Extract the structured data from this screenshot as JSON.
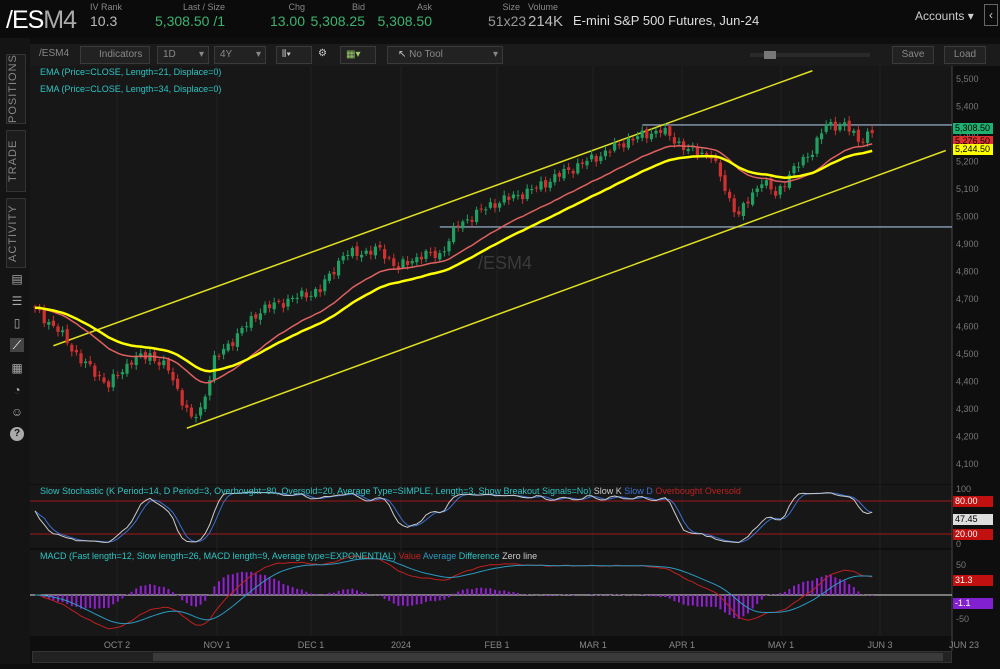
{
  "header": {
    "symbol_main": "/ES",
    "symbol_sub": "M4",
    "quotes": [
      {
        "label": "IV Rank",
        "value": "10.3",
        "color": "#bbbbbb"
      },
      {
        "label": "Last / Size",
        "value": "5,308.50 /1",
        "color": "#3cb371"
      },
      {
        "label": "Chg",
        "value": "13.00",
        "color": "#3cb371"
      },
      {
        "label": "Bid",
        "value": "5,308.25",
        "color": "#3cb371"
      },
      {
        "label": "Ask",
        "value": "5,308.50",
        "color": "#3cb371"
      },
      {
        "label": "Size",
        "value": "51x23",
        "color": "#999999"
      },
      {
        "label": "Volume",
        "value": "214K",
        "color": "#bbbbbb"
      }
    ],
    "description": "E-mini S&P 500 Futures, Jun-24",
    "accounts": "Accounts",
    "accounts_chevron": "▾",
    "collapse": "‹"
  },
  "sidebar": {
    "tabs": [
      "POSITIONS",
      "TRADE",
      "ACTIVITY"
    ],
    "icons": [
      "notes-icon",
      "list-icon",
      "clipboard-icon",
      "chart-drawing-icon",
      "grid-icon",
      "gauge-icon",
      "people-icon",
      "help-icon"
    ]
  },
  "toolbar": {
    "symbol": "/ESM4",
    "indicators": "Indicators",
    "aggregation": "1D",
    "timeframe": "4Y",
    "tool": "No Tool",
    "save": "Save",
    "load": "Load"
  },
  "chart_data": {
    "type": "candlestick",
    "watermark": "/ESM4",
    "legend": [
      "EMA (Price=CLOSE, Length=21, Displace=0)",
      "EMA (Price=CLOSE, Length=34, Displace=0)"
    ],
    "y_ticks": [
      "5,500",
      "5,400",
      "5,300",
      "5,200",
      "5,100",
      "5,000",
      "4,900",
      "4,800",
      "4,700",
      "4,600",
      "4,500",
      "4,400",
      "4,300",
      "4,200",
      "4,100"
    ],
    "ylim": [
      4050,
      5560
    ],
    "price_tags": [
      {
        "value": "5,308.50",
        "color": "#20b070"
      },
      {
        "value": "5,276.50",
        "color": "#e03030"
      },
      {
        "value": "5,244.50",
        "color": "#ffff00"
      }
    ],
    "horizontal_levels": [
      5333,
      4962
    ],
    "channel": {
      "upper": [
        [
          4,
          4530
        ],
        [
          169,
          5530
        ]
      ],
      "lower": [
        [
          33,
          4230
        ],
        [
          198,
          5240
        ]
      ]
    },
    "close_keypoints": [
      [
        0,
        4660
      ],
      [
        5,
        4587
      ],
      [
        10,
        4478
      ],
      [
        16,
        4387
      ],
      [
        21,
        4478
      ],
      [
        25,
        4497
      ],
      [
        29,
        4442
      ],
      [
        34,
        4260
      ],
      [
        36,
        4296
      ],
      [
        39,
        4478
      ],
      [
        45,
        4587
      ],
      [
        49,
        4660
      ],
      [
        55,
        4696
      ],
      [
        62,
        4733
      ],
      [
        67,
        4860
      ],
      [
        75,
        4878
      ],
      [
        79,
        4813
      ],
      [
        84,
        4860
      ],
      [
        88,
        4860
      ],
      [
        92,
        4969
      ],
      [
        99,
        5042
      ],
      [
        108,
        5096
      ],
      [
        116,
        5169
      ],
      [
        123,
        5224
      ],
      [
        129,
        5278
      ],
      [
        136,
        5315
      ],
      [
        142,
        5242
      ],
      [
        147,
        5224
      ],
      [
        151,
        5060
      ],
      [
        153,
        5005
      ],
      [
        158,
        5133
      ],
      [
        161,
        5078
      ],
      [
        164,
        5151
      ],
      [
        169,
        5242
      ],
      [
        172,
        5333
      ],
      [
        176,
        5333
      ],
      [
        179,
        5278
      ],
      [
        182,
        5308
      ]
    ],
    "x_ticks": [
      "OCT 2",
      "NOV 1",
      "DEC 1",
      "2024",
      "FEB 1",
      "MAR 1",
      "APR 1",
      "MAY 1",
      "JUN 3",
      "JUN 23"
    ]
  },
  "stochastic": {
    "title": "Slow Stochastic (K Period=14, D Period=3, Overbought=80, Oversold=20, Average Type=SIMPLE, Length=3, Show Breakout Signals=No)",
    "legend": [
      "Slow K",
      "Slow D",
      "Overbought",
      "Oversold"
    ],
    "ticks": [
      "100",
      "0"
    ],
    "tags": [
      "80.00",
      "47.45",
      "20.00"
    ]
  },
  "macd": {
    "title": "MACD (Fast length=12, Slow length=26, MACD length=9, Average type=EXPONENTIAL)",
    "legend": [
      "Value",
      "Average",
      "Difference",
      "Zero line"
    ],
    "ticks": [
      "50",
      "-50"
    ],
    "tags": [
      "31.3",
      "-1.1"
    ]
  }
}
